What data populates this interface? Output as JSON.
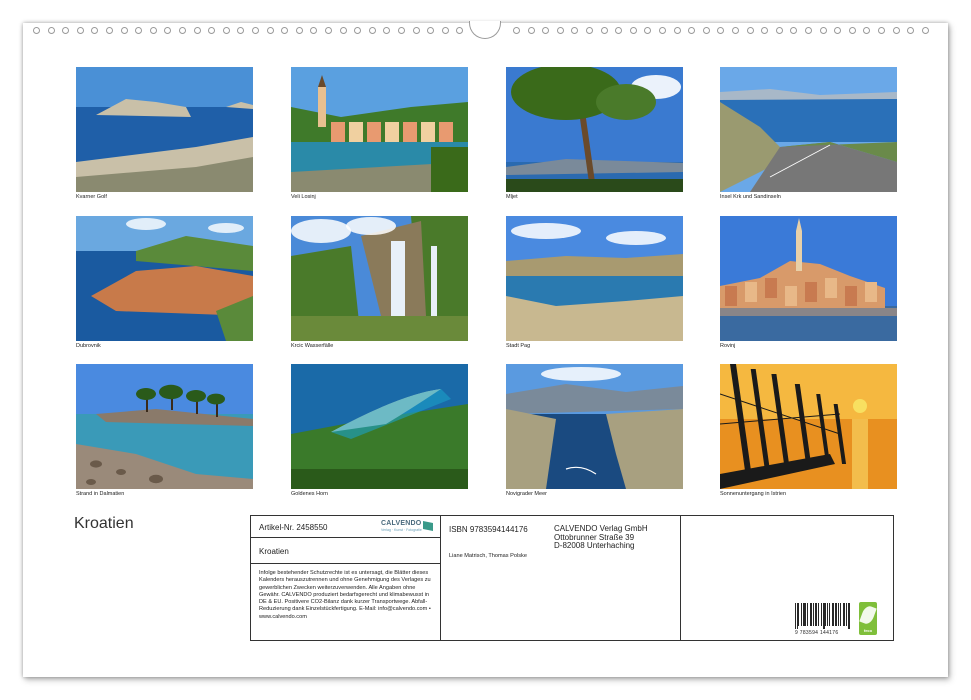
{
  "calendar": {
    "title": "Kroatien"
  },
  "photos": [
    {
      "caption": "Kvarner Golf",
      "scene": "bay-island",
      "sky": "#4a90d6",
      "water": "#1f5fa8",
      "land": "#c9c0a8",
      "accent": "#8a8a70"
    },
    {
      "caption": "Veli Losinj",
      "scene": "harbor-town",
      "sky": "#5aa0e0",
      "water": "#2a8aa8",
      "land": "#3f7a2a",
      "accent": "#e8c090"
    },
    {
      "caption": "Mljet",
      "scene": "pine-tree",
      "sky": "#3a7ad0",
      "water": "#2a6ab0",
      "land": "#3a6a1a",
      "accent": "#6a4a2a"
    },
    {
      "caption": "Insel Krk und Sandinseln",
      "scene": "coast-road",
      "sky": "#6aa8e8",
      "water": "#2a70b8",
      "land": "#9a9a70",
      "accent": "#777777"
    },
    {
      "caption": "Dubrovnik",
      "scene": "old-town",
      "sky": "#6aa8e0",
      "water": "#1a5aa0",
      "land": "#c87a4a",
      "accent": "#5a8a3a"
    },
    {
      "caption": "Krcic Wasserfälle",
      "scene": "waterfall",
      "sky": "#4a8ad8",
      "water": "#e8f0f8",
      "land": "#4a7a2a",
      "accent": "#8a7a5a"
    },
    {
      "caption": "Stadt Pag",
      "scene": "lagoon",
      "sky": "#4a8ae0",
      "water": "#2a7ab0",
      "land": "#a89a70",
      "accent": "#c8b890"
    },
    {
      "caption": "Rovinj",
      "scene": "church-town",
      "sky": "#3a7ad8",
      "water": "#3a6aa0",
      "land": "#d89a6a",
      "accent": "#e8d0a8"
    },
    {
      "caption": "Strand in Dalmatien",
      "scene": "rocky-beach",
      "sky": "#4a8ae0",
      "water": "#3a9ab8",
      "land": "#8a7a6a",
      "accent": "#2a5a1a"
    },
    {
      "caption": "Goldenes Horn",
      "scene": "sand-spit",
      "sky": "#1a6aa8",
      "water": "#1aa0c8",
      "land": "#3a7a2a",
      "accent": "#e8e0c0"
    },
    {
      "caption": "Novigrader Meer",
      "scene": "canyon-sea",
      "sky": "#5a9ae0",
      "water": "#1a4a80",
      "land": "#a8a080",
      "accent": "#7a7a5a"
    },
    {
      "caption": "Sonnenuntergang in Istrien",
      "scene": "sunset",
      "sky": "#f0a030",
      "water": "#e89020",
      "land": "#1a1a1a",
      "accent": "#f8e060"
    }
  ],
  "info": {
    "article": "Artikel-Nr. 2458550",
    "logo": "CALVENDO",
    "logo_sub": "Verlag · Kunst · Fotografie",
    "title": "Kroatien",
    "legal": "Infolge bestehender Schutzrechte ist es untersagt, die Blätter dieses Kalenders herauszutrennen und ohne Genehmigung des Verlages zu gewerblichen Zwecken weiterzuverwenden. Alle Angaben ohne Gewähr. CALVENDO produziert bedarfsgerecht und klimabewusst in DE & EU. Positivere CO2-Bilanz dank kurzer Transportwege. Abfall-Reduzierung dank Einzelstückfertigung. E-Mail: info@calvendo.com • www.calvendo.com",
    "isbn": "ISBN 9783594144176",
    "publisher_name": "CALVENDO Verlag GmbH",
    "publisher_street": "Ottobrunner Straße 39",
    "publisher_city": "D-82008 Unterhaching",
    "authors": "Liane Matrisch, Thomas Polske",
    "barcode_number": "9 783594 144176",
    "feco": "feco"
  }
}
